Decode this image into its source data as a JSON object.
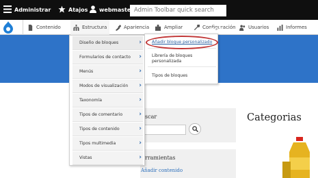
{
  "toolbar": {
    "manage_label": "Administrar",
    "shortcuts_label": "Atajos",
    "user_label": "webmaster",
    "search_placeholder": "Admin Toolbar quick search"
  },
  "tray": {
    "items": [
      {
        "label": "Contenido",
        "icon": "document-icon"
      },
      {
        "label": "Estructura",
        "icon": "sitemap-icon"
      },
      {
        "label": "Apariencia",
        "icon": "brush-icon"
      },
      {
        "label": "Ampliar",
        "icon": "puzzle-icon"
      },
      {
        "label": "Configuración",
        "icon": "wrench-icon"
      },
      {
        "label": "Usuarios",
        "icon": "users-icon"
      },
      {
        "label": "Informes",
        "icon": "bar-chart-icon"
      }
    ]
  },
  "structure_menu": {
    "items": [
      {
        "label": "Diseño de bloques"
      },
      {
        "label": "Formularios de contacto"
      },
      {
        "label": "Menús"
      },
      {
        "label": "Modos de visualización"
      },
      {
        "label": "Taxonomía"
      },
      {
        "label": "Tipos de comentario"
      },
      {
        "label": "Tipos de contenido"
      },
      {
        "label": "Tipos multimedia"
      },
      {
        "label": "Vistas"
      }
    ]
  },
  "block_submenu": {
    "items": [
      {
        "label": "Añadir bloque personalizado"
      },
      {
        "label": "Librería de bloques personalizada"
      },
      {
        "label": "Tipos de bloques"
      }
    ]
  },
  "page": {
    "hero_title_fragment": "ost",
    "search_label": "scar",
    "tools_label": "rramientas",
    "tools_link": "Añadir contenido",
    "categories_heading": "Categorias"
  },
  "colors": {
    "toolbar_bg": "#0f0f0f",
    "hero_bg": "#2e73c8",
    "highlight_oval": "#c03535",
    "link": "#2a6ebb"
  }
}
